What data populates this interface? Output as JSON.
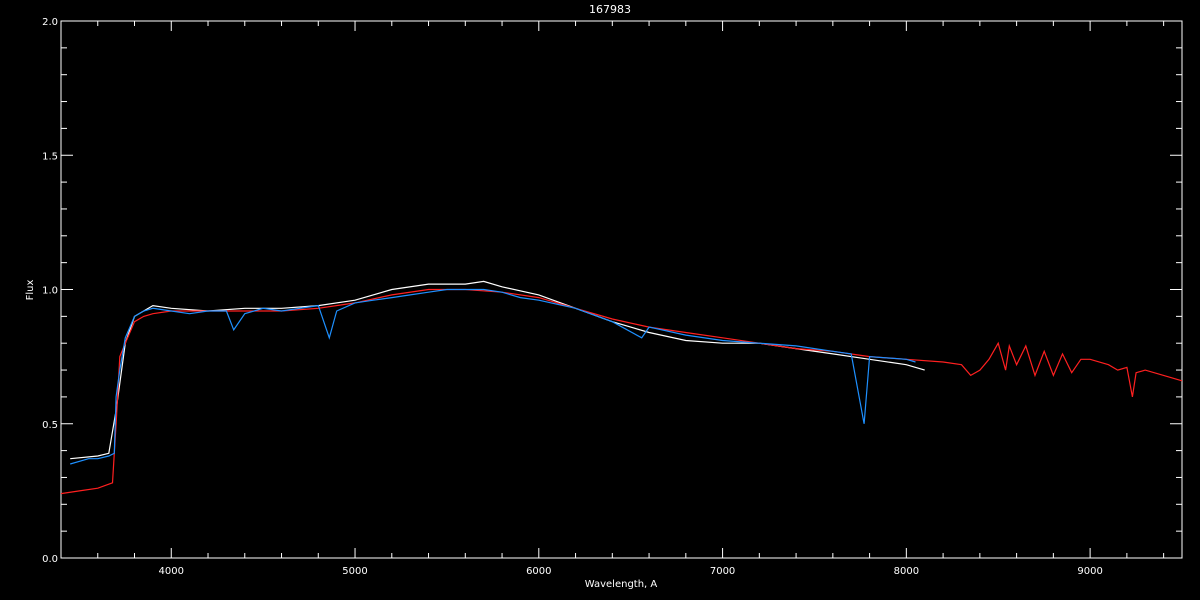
{
  "chart_data": {
    "type": "line",
    "title": "167983",
    "xlabel": "Wavelength, A",
    "ylabel": "Flux",
    "xlim": [
      3400,
      9500
    ],
    "ylim": [
      0.0,
      2.0
    ],
    "x_ticks": [
      4000,
      5000,
      6000,
      7000,
      8000,
      9000
    ],
    "x_tick_labels": [
      "4000",
      "5000",
      "6000",
      "7000",
      "8000",
      "9000"
    ],
    "y_ticks": [
      0.0,
      0.5,
      1.0,
      1.5,
      2.0
    ],
    "y_tick_labels": [
      "0.0",
      "0.5",
      "1.0",
      "1.5",
      "2.0"
    ],
    "grid": false,
    "background": "#000000",
    "axis_color": "#ffffff",
    "series": [
      {
        "color": "#ffffff",
        "x": [
          3450,
          3600,
          3660,
          3700,
          3750,
          3800,
          3850,
          3900,
          4000,
          4200,
          4400,
          4600,
          4800,
          5000,
          5200,
          5400,
          5600,
          5700,
          5800,
          6000,
          6200,
          6400,
          6600,
          6800,
          7000,
          7200,
          7400,
          7600,
          7800,
          8000,
          8100
        ],
        "y": [
          0.37,
          0.38,
          0.39,
          0.55,
          0.8,
          0.9,
          0.92,
          0.94,
          0.93,
          0.92,
          0.93,
          0.93,
          0.94,
          0.96,
          1.0,
          1.02,
          1.02,
          1.03,
          1.01,
          0.98,
          0.93,
          0.88,
          0.84,
          0.81,
          0.8,
          0.8,
          0.78,
          0.76,
          0.74,
          0.72,
          0.7
        ]
      },
      {
        "color": "#ff2020",
        "x": [
          3400,
          3500,
          3600,
          3680,
          3700,
          3720,
          3750,
          3800,
          3850,
          3900,
          4000,
          4200,
          4400,
          4600,
          4800,
          5000,
          5200,
          5400,
          5600,
          5800,
          6000,
          6200,
          6400,
          6600,
          6800,
          7000,
          7200,
          7400,
          7600,
          7800,
          8000,
          8200,
          8300,
          8350,
          8400,
          8450,
          8500,
          8540,
          8560,
          8600,
          8650,
          8700,
          8750,
          8800,
          8850,
          8900,
          8950,
          9000,
          9100,
          9150,
          9200,
          9230,
          9250,
          9300,
          9400,
          9500
        ],
        "y": [
          0.24,
          0.25,
          0.26,
          0.28,
          0.5,
          0.75,
          0.8,
          0.88,
          0.9,
          0.91,
          0.92,
          0.92,
          0.92,
          0.92,
          0.93,
          0.95,
          0.98,
          1.0,
          1.0,
          0.99,
          0.97,
          0.93,
          0.89,
          0.86,
          0.84,
          0.82,
          0.8,
          0.78,
          0.77,
          0.75,
          0.74,
          0.73,
          0.72,
          0.68,
          0.7,
          0.74,
          0.8,
          0.7,
          0.79,
          0.72,
          0.79,
          0.68,
          0.77,
          0.68,
          0.76,
          0.69,
          0.74,
          0.74,
          0.72,
          0.7,
          0.71,
          0.6,
          0.69,
          0.7,
          0.68,
          0.66
        ]
      },
      {
        "color": "#1e90ff",
        "x": [
          3450,
          3550,
          3600,
          3660,
          3690,
          3700,
          3720,
          3750,
          3800,
          3850,
          3900,
          4000,
          4100,
          4200,
          4300,
          4340,
          4400,
          4500,
          4600,
          4700,
          4800,
          4860,
          4900,
          5000,
          5100,
          5200,
          5300,
          5400,
          5500,
          5600,
          5700,
          5800,
          5900,
          6000,
          6200,
          6400,
          6560,
          6600,
          6800,
          7000,
          7200,
          7400,
          7600,
          7700,
          7770,
          7800,
          8000,
          8050
        ],
        "y": [
          0.35,
          0.37,
          0.37,
          0.38,
          0.39,
          0.6,
          0.7,
          0.82,
          0.9,
          0.92,
          0.93,
          0.92,
          0.91,
          0.92,
          0.92,
          0.85,
          0.91,
          0.93,
          0.92,
          0.93,
          0.94,
          0.82,
          0.92,
          0.95,
          0.96,
          0.97,
          0.98,
          0.99,
          1.0,
          1.0,
          1.0,
          0.99,
          0.97,
          0.96,
          0.93,
          0.88,
          0.82,
          0.86,
          0.83,
          0.81,
          0.8,
          0.79,
          0.77,
          0.76,
          0.5,
          0.75,
          0.74,
          0.73
        ]
      }
    ]
  }
}
